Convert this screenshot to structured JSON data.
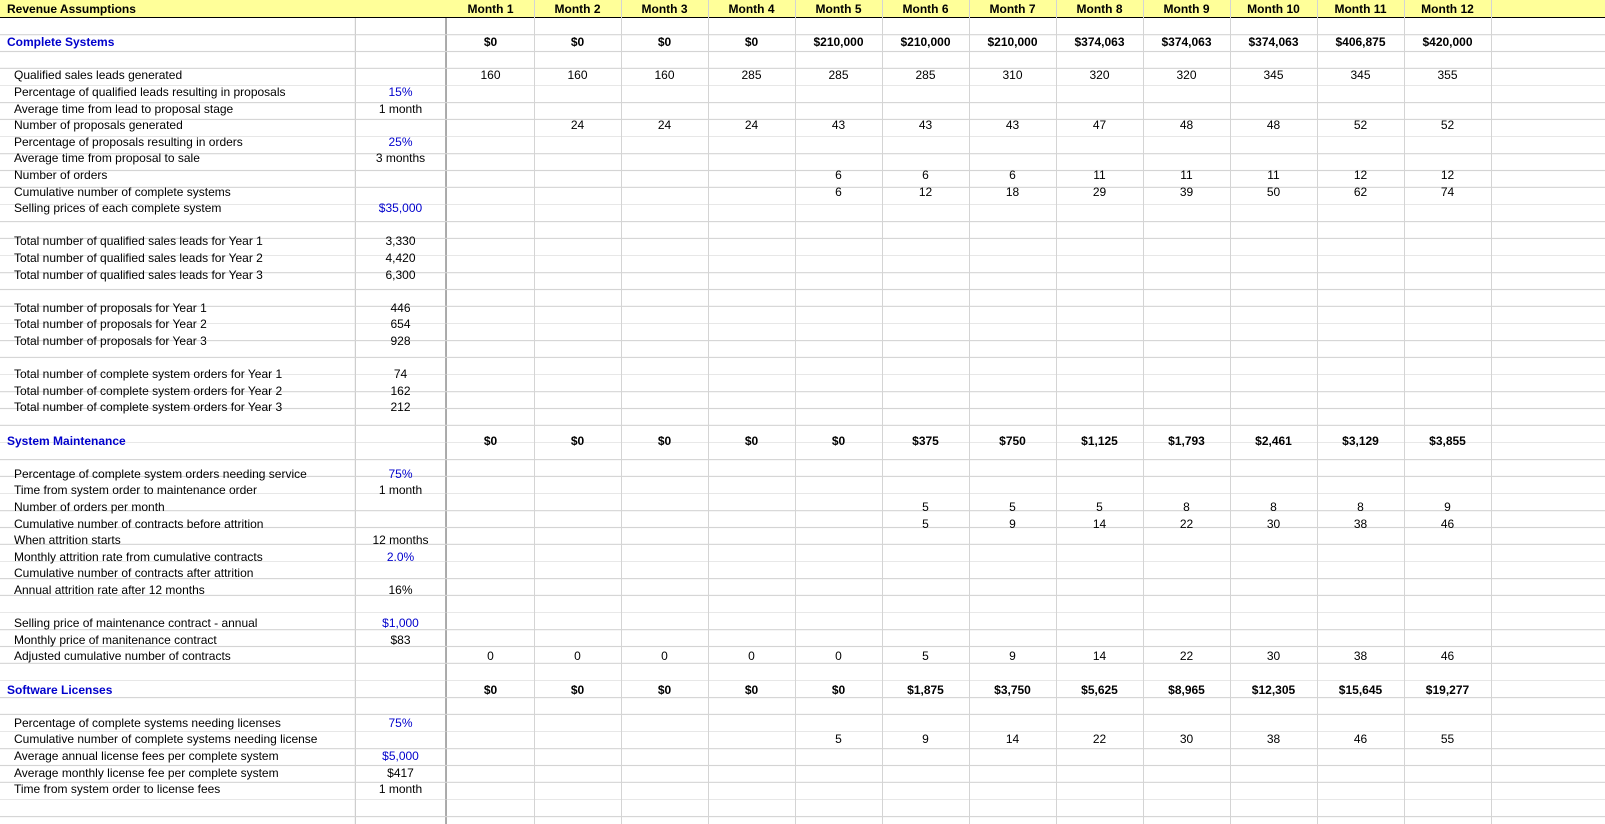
{
  "title": "Revenue Assumptions",
  "months": [
    "Month 1",
    "Month 2",
    "Month 3",
    "Month 4",
    "Month 5",
    "Month 6",
    "Month 7",
    "Month 8",
    "Month 9",
    "Month 10",
    "Month 11",
    "Month 12"
  ],
  "rows": [
    {
      "row": 2,
      "kind": "section",
      "label": "Complete Systems",
      "m": [
        "$0",
        "$0",
        "$0",
        "$0",
        "$210,000",
        "$210,000",
        "$210,000",
        "$374,063",
        "$374,063",
        "$374,063",
        "$406,875",
        "$420,000"
      ]
    },
    {
      "row": 4,
      "kind": "line",
      "label": "Qualified sales leads generated",
      "param": "",
      "m": [
        "160",
        "160",
        "160",
        "285",
        "285",
        "285",
        "310",
        "320",
        "320",
        "345",
        "345",
        "355"
      ]
    },
    {
      "row": 5,
      "kind": "line",
      "label": "Percentage of qualified leads resulting in proposals",
      "param": "15%",
      "paramBlue": true
    },
    {
      "row": 6,
      "kind": "line",
      "label": "Average time from lead to proposal stage",
      "param": "1 month"
    },
    {
      "row": 7,
      "kind": "line",
      "label": "Number of proposals generated",
      "param": "",
      "m": [
        "",
        "24",
        "24",
        "24",
        "43",
        "43",
        "43",
        "47",
        "48",
        "48",
        "52",
        "52"
      ]
    },
    {
      "row": 8,
      "kind": "line",
      "label": "Percentage of proposals resulting in orders",
      "param": "25%",
      "paramBlue": true
    },
    {
      "row": 9,
      "kind": "line",
      "label": "Average time from proposal to sale",
      "param": "3 months"
    },
    {
      "row": 10,
      "kind": "line",
      "label": "Number of orders",
      "param": "",
      "m": [
        "",
        "",
        "",
        "",
        "6",
        "6",
        "6",
        "11",
        "11",
        "11",
        "12",
        "12"
      ]
    },
    {
      "row": 11,
      "kind": "line",
      "label": "Cumulative number of complete systems",
      "param": "",
      "m": [
        "",
        "",
        "",
        "",
        "6",
        "12",
        "18",
        "29",
        "39",
        "50",
        "62",
        "74"
      ]
    },
    {
      "row": 12,
      "kind": "line",
      "label": "Selling prices of each complete system",
      "param": "$35,000",
      "paramBlue": true
    },
    {
      "row": 14,
      "kind": "line",
      "label": "Total number of qualified sales leads for Year 1",
      "param": "3,330"
    },
    {
      "row": 15,
      "kind": "line",
      "label": "Total number of qualified sales leads for Year 2",
      "param": "4,420"
    },
    {
      "row": 16,
      "kind": "line",
      "label": "Total number of qualified sales leads for Year 3",
      "param": "6,300"
    },
    {
      "row": 18,
      "kind": "line",
      "label": "Total number of proposals for Year 1",
      "param": "446"
    },
    {
      "row": 19,
      "kind": "line",
      "label": "Total number of proposals for Year 2",
      "param": "654"
    },
    {
      "row": 20,
      "kind": "line",
      "label": "Total number of proposals for Year 3",
      "param": "928"
    },
    {
      "row": 22,
      "kind": "line",
      "label": "Total number of complete system orders for Year 1",
      "param": "74"
    },
    {
      "row": 23,
      "kind": "line",
      "label": "Total number of complete system orders for Year 2",
      "param": "162"
    },
    {
      "row": 24,
      "kind": "line",
      "label": "Total number of complete system orders for Year 3",
      "param": "212"
    },
    {
      "row": 26,
      "kind": "section",
      "label": "System Maintenance",
      "m": [
        "$0",
        "$0",
        "$0",
        "$0",
        "$0",
        "$375",
        "$750",
        "$1,125",
        "$1,793",
        "$2,461",
        "$3,129",
        "$3,855"
      ]
    },
    {
      "row": 28,
      "kind": "line",
      "label": "Percentage of complete system orders needing service",
      "param": "75%",
      "paramBlue": true
    },
    {
      "row": 29,
      "kind": "line",
      "label": "Time from system order to maintenance order",
      "param": "1 month"
    },
    {
      "row": 30,
      "kind": "line",
      "label": "Number of orders per month",
      "param": "",
      "m": [
        "",
        "",
        "",
        "",
        "",
        "5",
        "5",
        "5",
        "8",
        "8",
        "8",
        "9"
      ]
    },
    {
      "row": 31,
      "kind": "line",
      "label": "Cumulative number of contracts before attrition",
      "param": "",
      "m": [
        "",
        "",
        "",
        "",
        "",
        "5",
        "9",
        "14",
        "22",
        "30",
        "38",
        "46"
      ]
    },
    {
      "row": 32,
      "kind": "line",
      "label": "When attrition starts",
      "param": "12 months"
    },
    {
      "row": 33,
      "kind": "line",
      "label": "Monthly attrition rate from cumulative contracts",
      "param": "2.0%",
      "paramBlue": true
    },
    {
      "row": 34,
      "kind": "line",
      "label": "Cumulative number of contracts after attrition",
      "param": ""
    },
    {
      "row": 35,
      "kind": "line",
      "label": "Annual attrition rate after 12 months",
      "param": "16%"
    },
    {
      "row": 37,
      "kind": "line",
      "label": "Selling price of maintenance contract - annual",
      "param": "$1,000",
      "paramBlue": true
    },
    {
      "row": 38,
      "kind": "line",
      "label": "Monthly price of manitenance contract",
      "param": "$83"
    },
    {
      "row": 39,
      "kind": "line",
      "label": "Adjusted cumulative number of contracts",
      "param": "",
      "m": [
        "0",
        "0",
        "0",
        "0",
        "0",
        "5",
        "9",
        "14",
        "22",
        "30",
        "38",
        "46"
      ]
    },
    {
      "row": 41,
      "kind": "section",
      "label": "Software Licenses",
      "m": [
        "$0",
        "$0",
        "$0",
        "$0",
        "$0",
        "$1,875",
        "$3,750",
        "$5,625",
        "$8,965",
        "$12,305",
        "$15,645",
        "$19,277"
      ]
    },
    {
      "row": 43,
      "kind": "line",
      "label": "Percentage of complete systems needing licenses",
      "param": "75%",
      "paramBlue": true
    },
    {
      "row": 44,
      "kind": "line",
      "label": "Cumulative number of complete systems needing license",
      "param": "",
      "m": [
        "",
        "",
        "",
        "",
        "5",
        "9",
        "14",
        "22",
        "30",
        "38",
        "46",
        "55"
      ]
    },
    {
      "row": 45,
      "kind": "line",
      "label": "Average annual license fees per complete system",
      "param": "$5,000",
      "paramBlue": true
    },
    {
      "row": 46,
      "kind": "line",
      "label": "Average monthly license fee per complete system",
      "param": "$417"
    },
    {
      "row": 47,
      "kind": "line",
      "label": "Time from system order to license fees",
      "param": "1 month"
    }
  ]
}
